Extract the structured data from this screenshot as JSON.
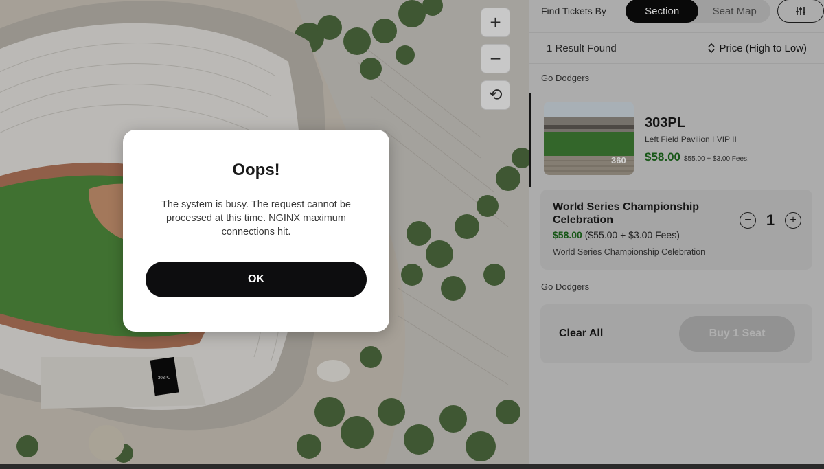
{
  "map": {
    "controls": {
      "zoom_in": "+",
      "zoom_out": "−",
      "reset": "⟲"
    },
    "selected_section_label": "303PL"
  },
  "panel": {
    "find_label": "Find Tickets By",
    "tabs": [
      {
        "label": "Section",
        "active": true
      },
      {
        "label": "Seat Map",
        "active": false
      }
    ],
    "results_count": "1 Result Found",
    "sort_label": "Price (High to Low)",
    "group_label_1": "Go Dodgers",
    "ticket": {
      "section": "303PL",
      "description": "Left Field Pavilion I VIP II",
      "price": "$58.00",
      "fees": "$55.00 + $3.00 Fees.",
      "thumb_badge": "360"
    },
    "cart": {
      "title": "World Series Championship Celebration",
      "price": "$58.00",
      "price_detail": "($55.00 + $3.00 Fees)",
      "event": "World Series Championship Celebration",
      "quantity": "1",
      "minus": "−",
      "plus": "+"
    },
    "group_label_2": "Go Dodgers",
    "clear_all": "Clear All",
    "buy_label": "Buy 1 Seat"
  },
  "modal": {
    "title": "Oops!",
    "message": "The system is busy. The request cannot be processed at this time. NGINX maximum connections hit.",
    "ok_label": "OK"
  },
  "colors": {
    "accent_dark": "#0b0b0b",
    "price_green": "#1d6b1d",
    "panel_bg": "#d2d2d2",
    "modal_bg": "#ffffff"
  }
}
